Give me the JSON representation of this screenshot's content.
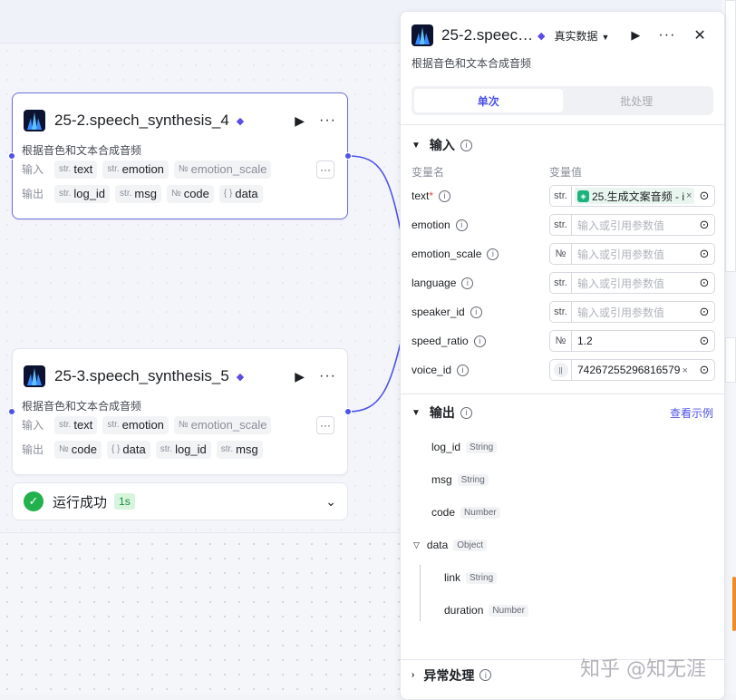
{
  "canvas": {
    "nodes": [
      {
        "title": "25-2.speech_synthesis_4",
        "description": "根据音色和文本合成音频",
        "input_label": "输入",
        "inputs": [
          {
            "type": "str.",
            "name": "text"
          },
          {
            "type": "str.",
            "name": "emotion"
          },
          {
            "type": "№",
            "name": "emotion_scale"
          }
        ],
        "output_label": "输出",
        "outputs": [
          {
            "type": "str.",
            "name": "log_id"
          },
          {
            "type": "str.",
            "name": "msg"
          },
          {
            "type": "№",
            "name": "code"
          },
          {
            "type": "{ }",
            "name": "data"
          }
        ],
        "more_label": "···"
      },
      {
        "title": "25-3.speech_synthesis_5",
        "description": "根据音色和文本合成音频",
        "input_label": "输入",
        "inputs": [
          {
            "type": "str.",
            "name": "text"
          },
          {
            "type": "str.",
            "name": "emotion"
          },
          {
            "type": "№",
            "name": "emotion_scale"
          }
        ],
        "output_label": "输出",
        "outputs": [
          {
            "type": "№",
            "name": "code"
          },
          {
            "type": "{ }",
            "name": "data"
          },
          {
            "type": "str.",
            "name": "log_id"
          },
          {
            "type": "str.",
            "name": "msg"
          }
        ],
        "more_label": "···"
      }
    ],
    "run_status": {
      "text": "运行成功",
      "duration": "1s"
    }
  },
  "panel": {
    "title": "25-2.speec…",
    "mode": "真实数据",
    "description": "根据音色和文本合成音频",
    "tabs": [
      {
        "label": "单次",
        "active": true
      },
      {
        "label": "批处理",
        "active": false
      }
    ],
    "input_section": {
      "title": "输入",
      "col_name": "变量名",
      "col_value": "变量值",
      "params": [
        {
          "name": "text",
          "required": true,
          "type": "str.",
          "value": "25.生成文案音频 - i",
          "kind": "ref"
        },
        {
          "name": "emotion",
          "required": false,
          "type": "str.",
          "value": "输入或引用参数值",
          "kind": "placeholder"
        },
        {
          "name": "emotion_scale",
          "required": false,
          "type": "№",
          "value": "输入或引用参数值",
          "kind": "placeholder"
        },
        {
          "name": "language",
          "required": false,
          "type": "str.",
          "value": "输入或引用参数值",
          "kind": "placeholder"
        },
        {
          "name": "speaker_id",
          "required": false,
          "type": "str.",
          "value": "输入或引用参数值",
          "kind": "placeholder"
        },
        {
          "name": "speed_ratio",
          "required": false,
          "type": "№",
          "value": "1.2",
          "kind": "value"
        },
        {
          "name": "voice_id",
          "required": false,
          "type": "",
          "value": "74267255296816579",
          "kind": "voice"
        }
      ]
    },
    "output_section": {
      "title": "输出",
      "example_link": "查看示例",
      "fields": [
        {
          "name": "log_id",
          "type": "String",
          "level": 0
        },
        {
          "name": "msg",
          "type": "String",
          "level": 0
        },
        {
          "name": "code",
          "type": "Number",
          "level": 0
        },
        {
          "name": "data",
          "type": "Object",
          "level": 0,
          "expanded": true
        },
        {
          "name": "link",
          "type": "String",
          "level": 1
        },
        {
          "name": "duration",
          "type": "Number",
          "level": 1
        }
      ]
    },
    "error_section": {
      "title": "异常处理"
    }
  },
  "watermark": "知乎 @知无涯",
  "colors": {
    "accent": "#4d53e8",
    "success": "#22b14c",
    "required": "#e54545",
    "edge": "#4d53e8"
  }
}
